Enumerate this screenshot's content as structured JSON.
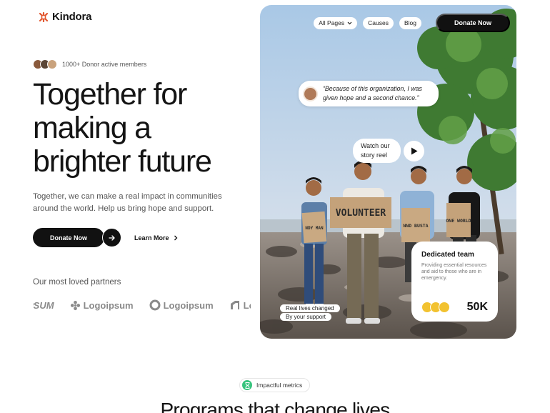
{
  "brand": {
    "name": "Kindora",
    "accent": "#e2572f"
  },
  "members": {
    "text": "1000+ Donor active members"
  },
  "hero": {
    "headline_line1": "Together for",
    "headline_line2": "making a",
    "headline_line3": "brighter future",
    "subtext": "Together, we can make a real impact in communities around the world. Help us bring hope and support.",
    "donate_label": "Donate Now",
    "learn_more_label": "Learn More"
  },
  "partners": {
    "title": "Our most loved partners",
    "items": [
      "PSUM",
      "Logoipsum",
      "Logoipsum",
      "Logo"
    ]
  },
  "nav": {
    "items": [
      "All Pages",
      "Causes",
      "Blog"
    ],
    "donate_label": "Donate Now"
  },
  "quote": {
    "text": "“Because of this organization, I was given hope and a second chance.”"
  },
  "video": {
    "label": "Watch our story reel"
  },
  "team_card": {
    "title": "Dedicated team",
    "description": "Providing essential resources and aid to those who are in emergency.",
    "count": "50K"
  },
  "image_tags": [
    "Real lives changed",
    "By your support"
  ],
  "signs": [
    "VOLUNTEER",
    "NDY MAN",
    "NND BUSTA",
    "ONE WORLD"
  ],
  "metrics": {
    "badge": "Impactful metrics",
    "section_title": "Programs that change lives"
  }
}
